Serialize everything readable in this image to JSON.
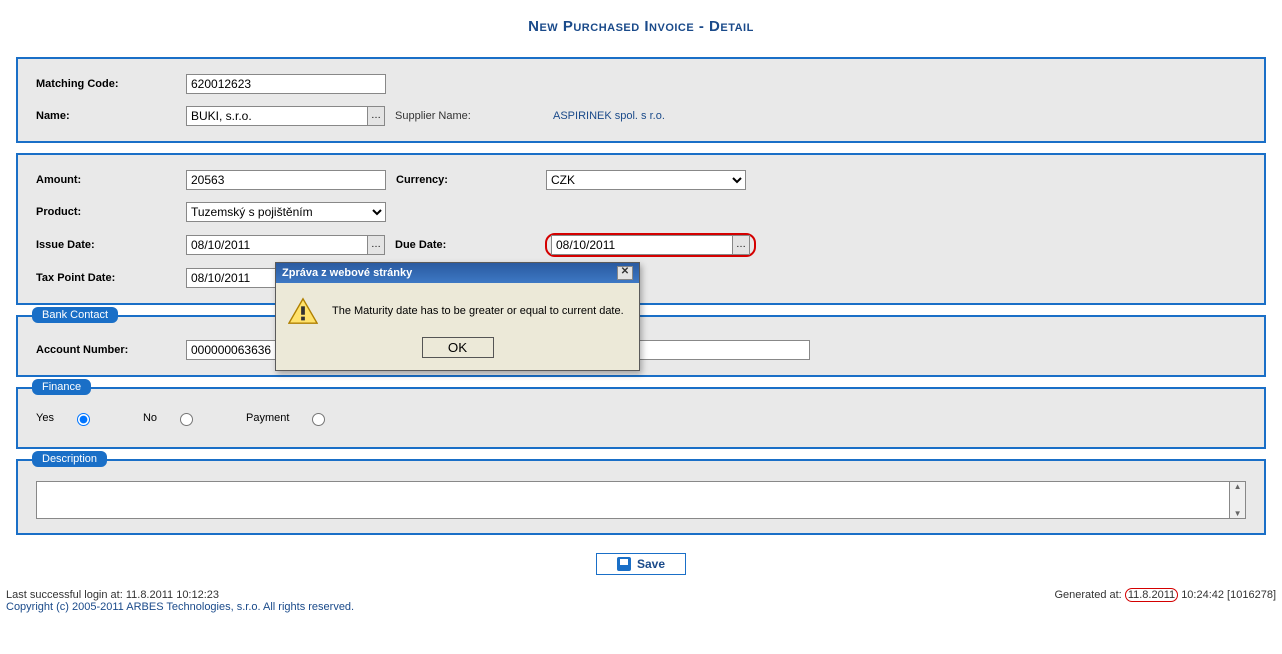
{
  "title": "New Purchased Invoice - Detail",
  "section1": {
    "matching_code_label": "Matching Code:",
    "matching_code_value": "620012623",
    "name_label": "Name:",
    "name_value": "BUKI, s.r.o.",
    "supplier_name_label": "Supplier Name:",
    "supplier_name_value": "ASPIRINEK spol. s r.o."
  },
  "section2": {
    "amount_label": "Amount:",
    "amount_value": "20563",
    "currency_label": "Currency:",
    "currency_value": "CZK",
    "product_label": "Product:",
    "product_value": "Tuzemský s pojištěním",
    "issue_date_label": "Issue Date:",
    "issue_date_value": "08/10/2011",
    "due_date_label": "Due Date:",
    "due_date_value": "08/10/2011",
    "tax_point_label": "Tax Point Date:",
    "tax_point_value": "08/10/2011"
  },
  "bank": {
    "legend": "Bank Contact",
    "account_label": "Account Number:",
    "account_value": "000000063636"
  },
  "finance": {
    "legend": "Finance",
    "yes": "Yes",
    "no": "No",
    "payment": "Payment"
  },
  "description": {
    "legend": "Description",
    "value": ""
  },
  "save_label": "Save",
  "modal": {
    "title": "Zpráva z webové stránky",
    "message": "The Maturity date has to be greater or equal to current date.",
    "ok": "OK"
  },
  "footer": {
    "login": "Last successful login at: 11.8.2011 10:12:23",
    "copyright": "Copyright (c) 2005-2011 ARBES Technologies, s.r.o. All rights reserved.",
    "generated_prefix": "Generated at:",
    "generated_date": "11.8.2011",
    "generated_rest": "10:24:42 [1016278]"
  }
}
